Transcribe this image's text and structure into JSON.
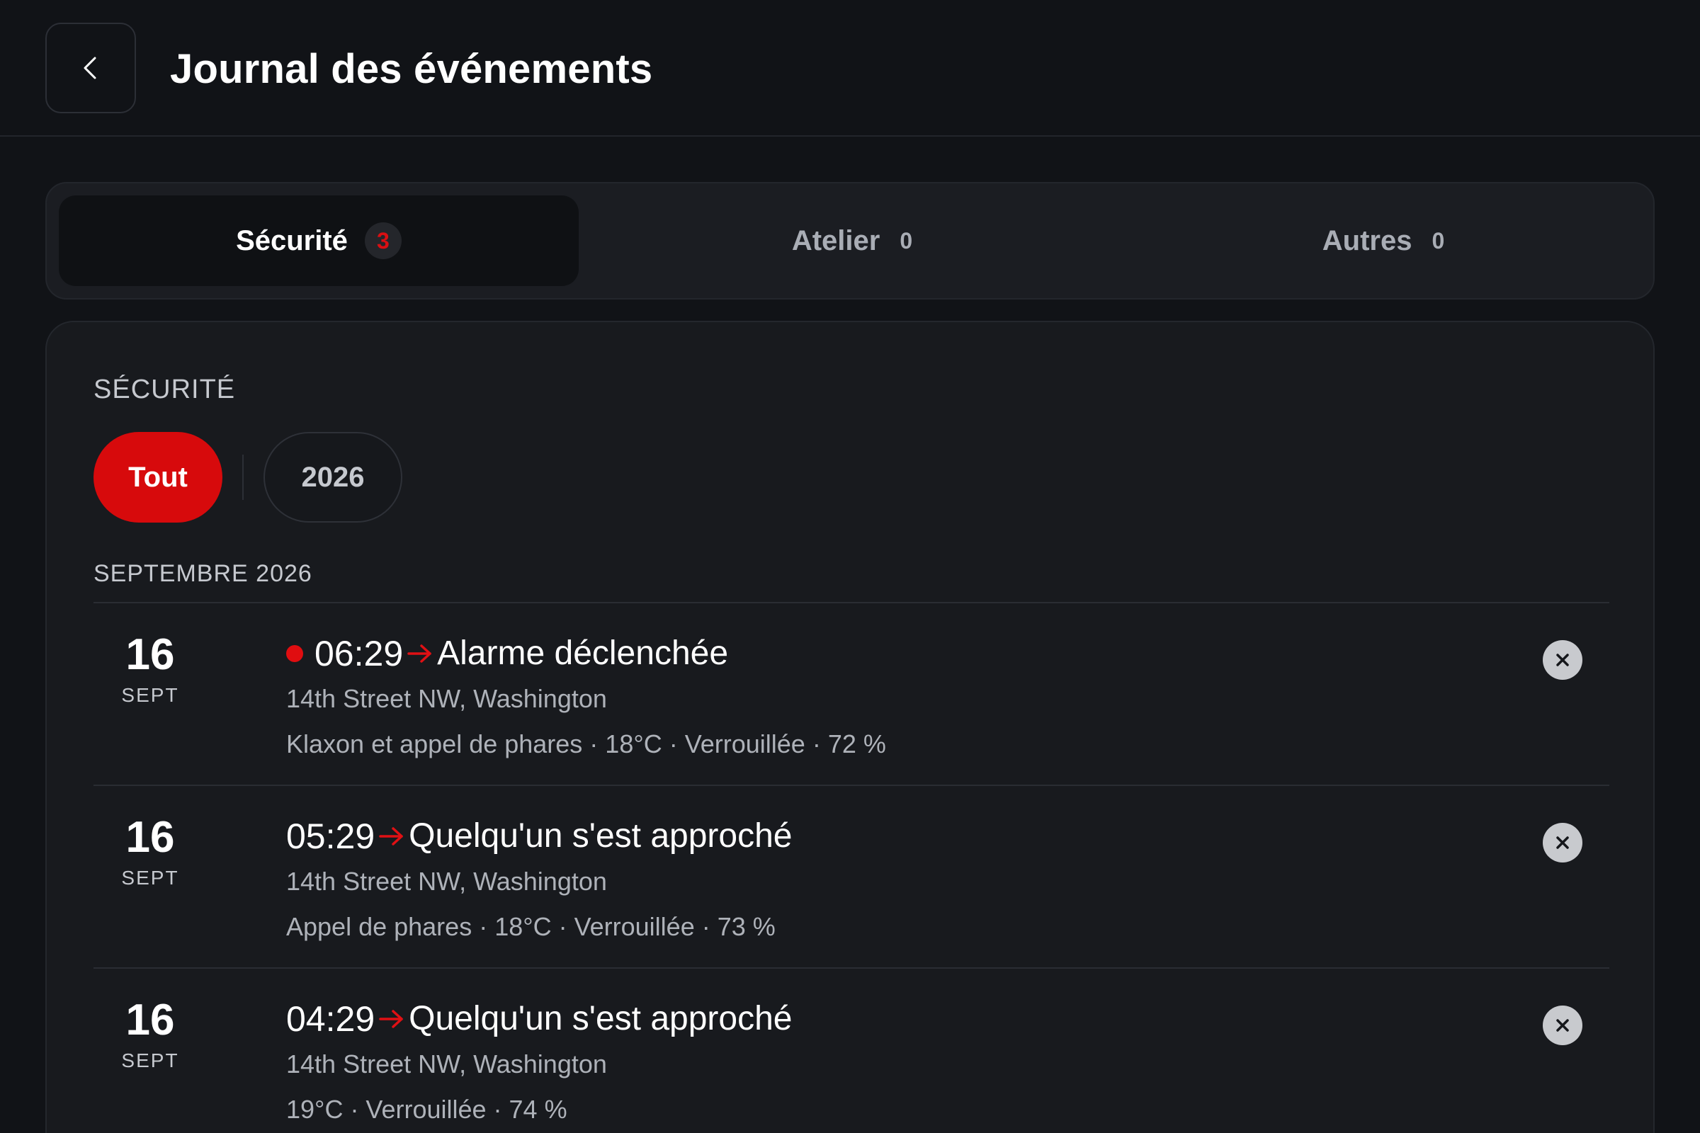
{
  "header": {
    "title": "Journal des événements",
    "back_icon": "chevron-left-icon"
  },
  "tabs": [
    {
      "label": "Sécurité",
      "count": "3",
      "active": true
    },
    {
      "label": "Atelier",
      "count": "0",
      "active": false
    },
    {
      "label": "Autres",
      "count": "0",
      "active": false
    }
  ],
  "panel": {
    "section_label": "SÉCURITÉ",
    "filters": {
      "all": "Tout",
      "year": "2026"
    },
    "month_label": "SEPTEMBRE 2026"
  },
  "events": [
    {
      "day": "16",
      "month": "SEPT",
      "time": "06:29",
      "title": "Alarme déclenchée",
      "location": "14th Street NW, Washington",
      "details": "Klaxon et appel de phares · 18°C · Verrouillée · 72 %",
      "unread": true
    },
    {
      "day": "16",
      "month": "SEPT",
      "time": "05:29",
      "title": "Quelqu'un s'est approché",
      "location": "14th Street NW, Washington",
      "details": "Appel de phares · 18°C · Verrouillée · 73 %",
      "unread": false
    },
    {
      "day": "16",
      "month": "SEPT",
      "time": "04:29",
      "title": "Quelqu'un s'est approché",
      "location": "14th Street NW, Washington",
      "details": "19°C · Verrouillée · 74 %",
      "unread": false
    }
  ],
  "colors": {
    "accent": "#d70a0c",
    "background": "#111317",
    "panel": "#181a1e"
  }
}
